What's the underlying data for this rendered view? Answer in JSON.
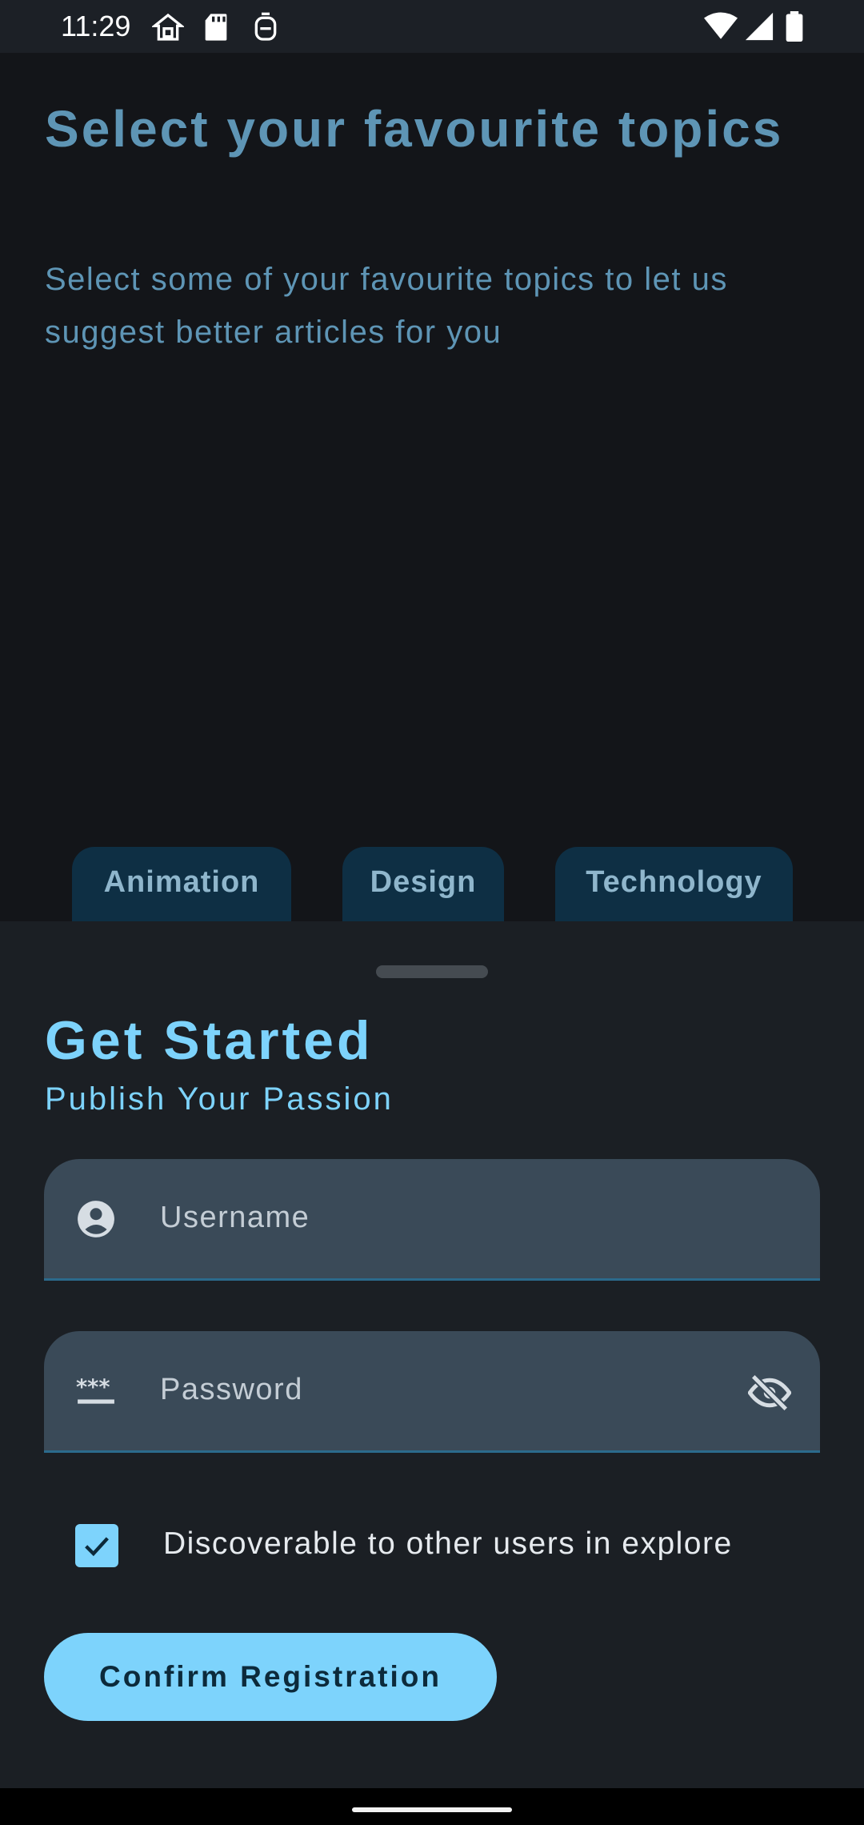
{
  "status_bar": {
    "time": "11:29",
    "left_icons": [
      "home-icon",
      "sd-card-icon",
      "sim-icon"
    ],
    "right_icons": [
      "wifi-icon",
      "cellular-signal-icon",
      "battery-icon"
    ]
  },
  "topics_page": {
    "title": "Select your favourite topics",
    "subtitle": "Select some of your favourite topics to let us suggest better articles for you",
    "chips": [
      {
        "label": "Animation"
      },
      {
        "label": "Design"
      },
      {
        "label": "Technology"
      }
    ]
  },
  "sheet": {
    "title": "Get Started",
    "subtitle": "Publish Your Passion",
    "username": {
      "placeholder": "Username",
      "icon": "account-circle-icon"
    },
    "password": {
      "placeholder": "Password",
      "icon": "password-dots-icon",
      "toggle_icon": "visibility-off-icon"
    },
    "discoverable": {
      "label": "Discoverable to other users in explore",
      "checked": true
    },
    "confirm_label": "Confirm Registration"
  },
  "colors": {
    "accent": "#7dd3fc",
    "background": "#131519",
    "sheet": "#1b1f24",
    "field": "#3a4a58",
    "chip": "#0e2f44"
  }
}
